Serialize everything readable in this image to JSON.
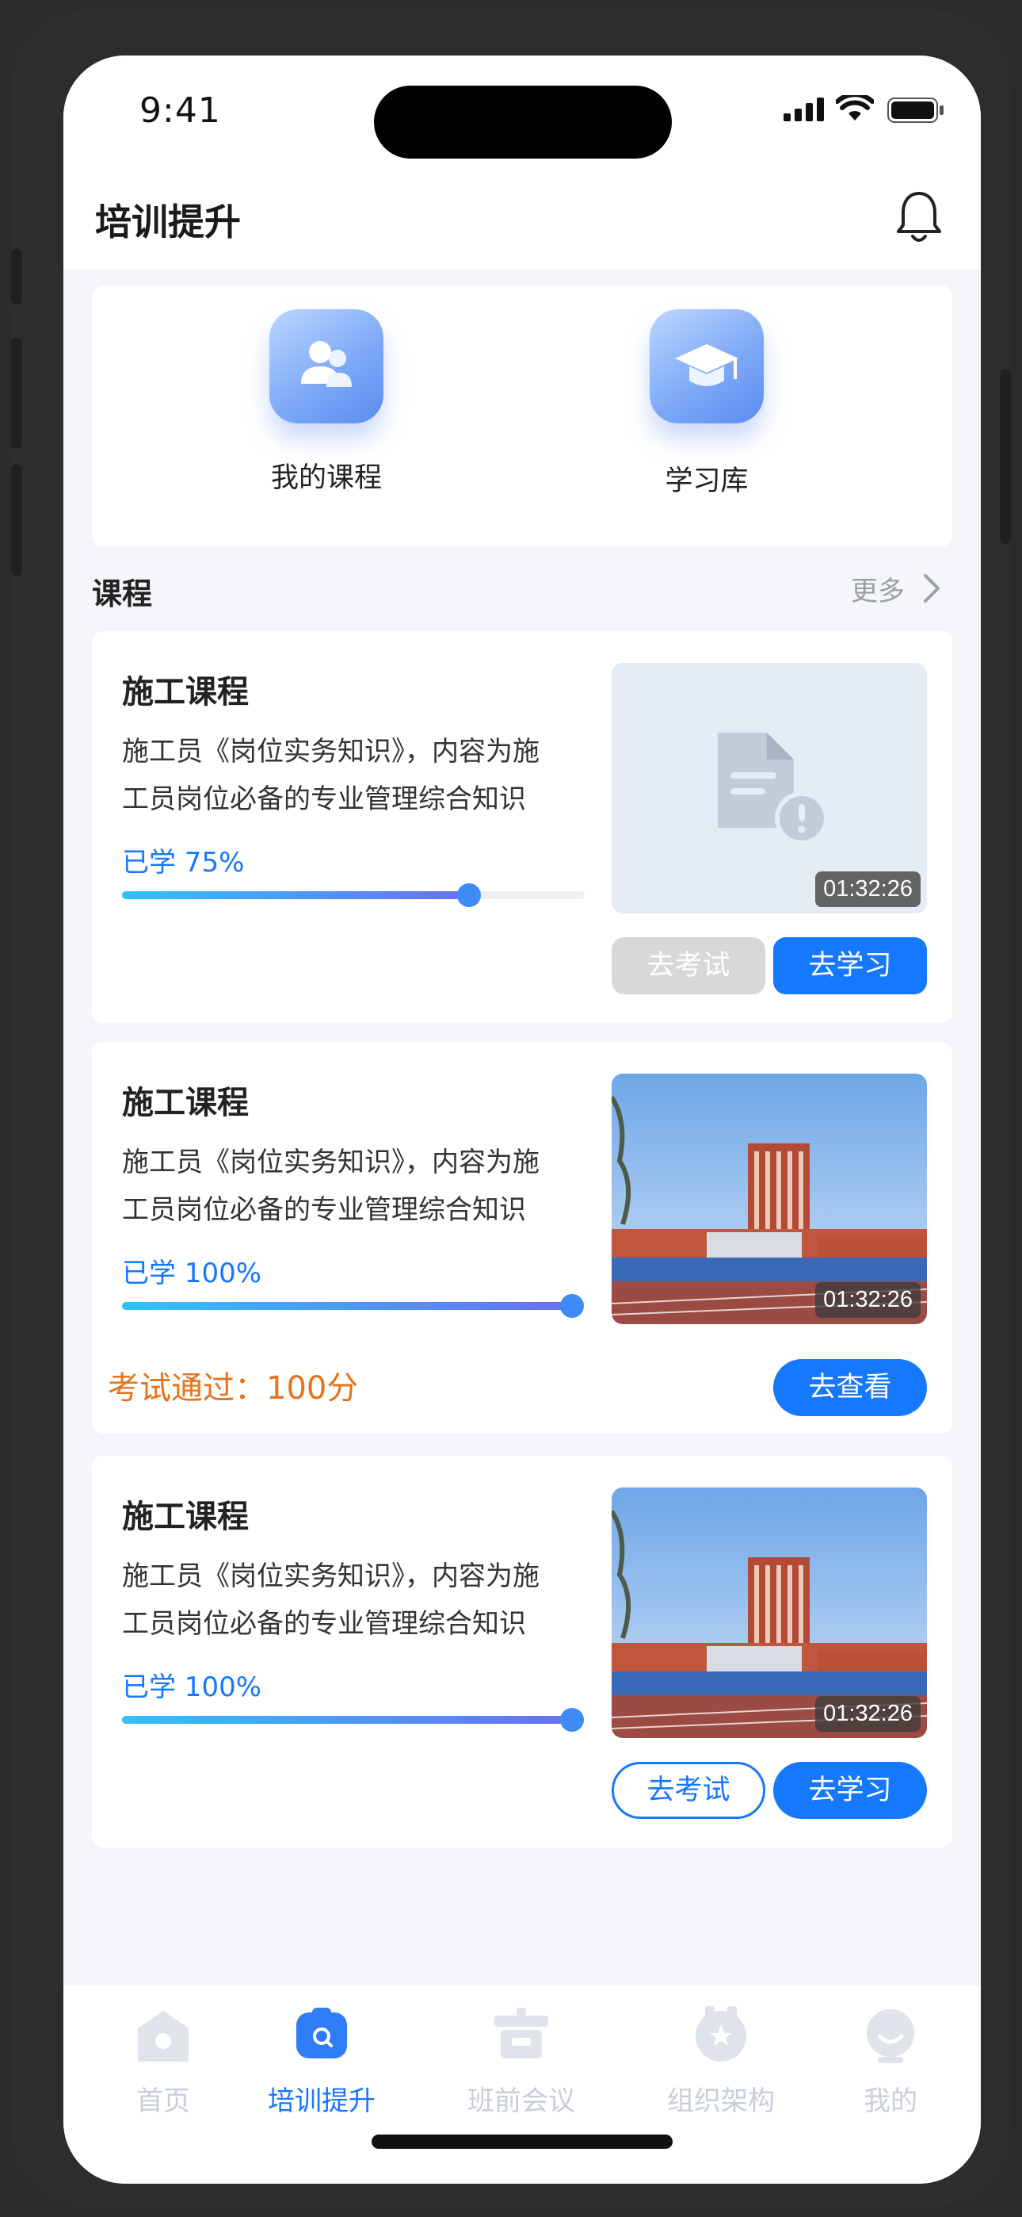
{
  "status_bar": {
    "time": "9:41"
  },
  "header": {
    "title": "培训提升"
  },
  "quick_actions": [
    {
      "label": "我的课程",
      "icon": "users-icon"
    },
    {
      "label": "学习库",
      "icon": "graduation-cap-icon"
    }
  ],
  "section": {
    "title": "课程",
    "more": "更多"
  },
  "courses": [
    {
      "title": "施工课程",
      "desc_line1": "施工员《岗位实务知识》，内容为施",
      "desc_line2": "工员岗位必备的专业管理综合知识",
      "progress_label": "已学 75%",
      "progress": 0.75,
      "duration": "01:32:26",
      "thumbnail": "document-alert-icon",
      "buttons": [
        "去考试",
        "去学习"
      ]
    },
    {
      "title": "施工课程",
      "desc_line1": "施工员《岗位实务知识》，内容为施",
      "desc_line2": "工员岗位必备的专业管理综合知识",
      "progress_label": "已学 100%",
      "progress": 1.0,
      "duration": "01:32:26",
      "thumbnail": "campus-photo",
      "exam_result": "考试通过：100分",
      "buttons": [
        "去查看"
      ]
    },
    {
      "title": "施工课程",
      "desc_line1": "施工员《岗位实务知识》，内容为施",
      "desc_line2": "工员岗位必备的专业管理综合知识",
      "progress_label": "已学 100%",
      "progress": 1.0,
      "duration": "01:32:26",
      "thumbnail": "campus-photo",
      "buttons": [
        "去考试",
        "去学习"
      ]
    }
  ],
  "tabs": [
    {
      "label": "首页",
      "icon": "home-icon",
      "active": false
    },
    {
      "label": "培训提升",
      "icon": "chat-icon",
      "active": true
    },
    {
      "label": "班前会议",
      "icon": "meeting-icon",
      "active": false
    },
    {
      "label": "组织架构",
      "icon": "badge-icon",
      "active": false
    },
    {
      "label": "我的",
      "icon": "profile-icon",
      "active": false
    }
  ],
  "colors": {
    "accent": "#1677ff",
    "warning": "#e8731a",
    "disabled": "#d8d8d8",
    "tab_inactive": "#c8ced9"
  }
}
